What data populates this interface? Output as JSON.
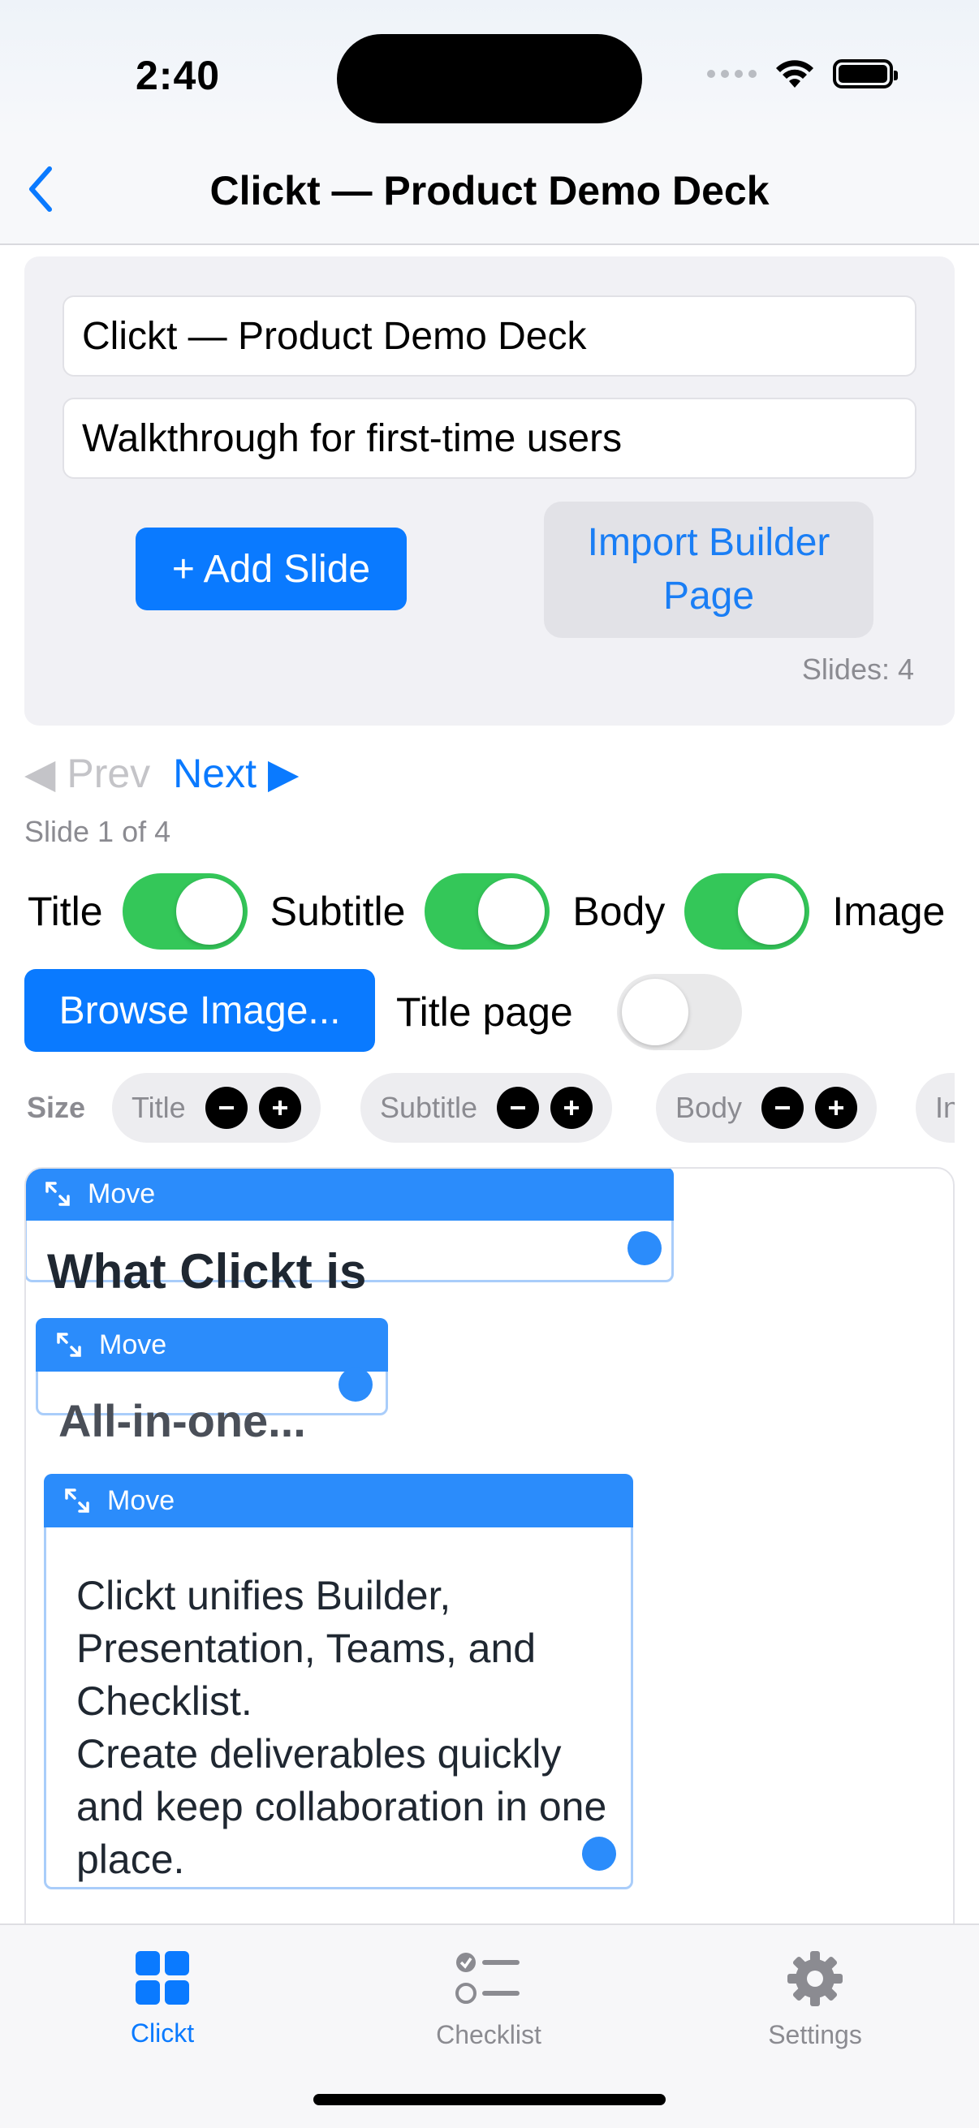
{
  "status": {
    "time": "2:40"
  },
  "nav": {
    "title": "Clickt — Product Demo Deck"
  },
  "deck": {
    "title_value": "Clickt — Product Demo Deck",
    "subtitle_value": "Walkthrough for first-time users",
    "add_slide_label": "+ Add Slide",
    "import_label": "Import Builder Page",
    "slides_count": "Slides: 4"
  },
  "pager": {
    "prev_label": "◀ Prev",
    "next_label": "Next ▶",
    "position": "Slide 1 of 4"
  },
  "toggles": {
    "title_label": "Title",
    "title_on": true,
    "subtitle_label": "Subtitle",
    "subtitle_on": true,
    "body_label": "Body",
    "body_on": true,
    "image_label": "Image",
    "browse_label": "Browse Image...",
    "title_page_label": "Title page",
    "title_page_on": false
  },
  "size": {
    "label": "Size",
    "chips": [
      "Title",
      "Subtitle",
      "Body",
      "In"
    ]
  },
  "slide": {
    "move_label": "Move",
    "title": "What Clickt is",
    "subtitle": "All-in-one...",
    "body": "Clickt unifies Builder, Presentation, Teams, and Checklist.\nCreate deliverables quickly and keep collaboration in one place."
  },
  "tabs": [
    {
      "label": "Clickt",
      "icon": "grid-icon",
      "active": true
    },
    {
      "label": "Checklist",
      "icon": "checklist-icon",
      "active": false
    },
    {
      "label": "Settings",
      "icon": "gear-icon",
      "active": false
    }
  ],
  "colors": {
    "accent": "#0a7aff",
    "toggle_on": "#34c759",
    "move_bar": "#2b8cfb"
  }
}
